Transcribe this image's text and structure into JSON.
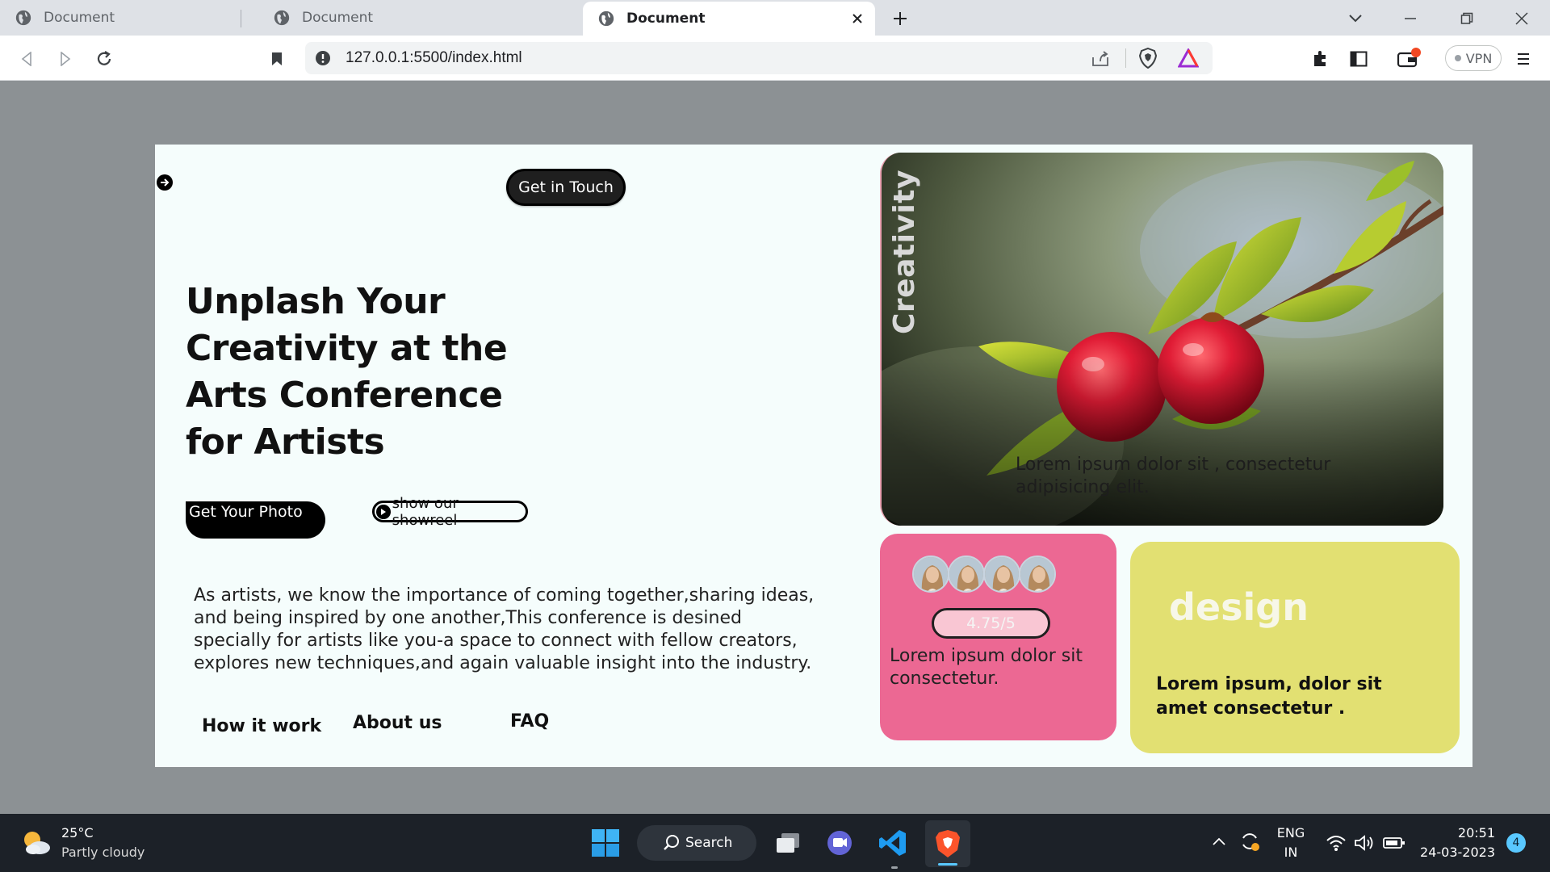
{
  "browser": {
    "tabs": [
      {
        "title": "Document",
        "active": false
      },
      {
        "title": "Document",
        "active": false
      },
      {
        "title": "Document",
        "active": true
      }
    ],
    "url": "127.0.0.1:5500/index.html",
    "vpn_label": "VPN"
  },
  "page": {
    "cta_touch": "Get in Touch",
    "hero_title": "Unplash Your Creativity at the Arts Conference for Artists",
    "btn_photo": "Get Your Photo",
    "btn_showreel": "show our showreel",
    "intro": "As artists, we know the importance of coming together,sharing ideas, and being inspired by one another,This conference is desined specially for artists like you-a space to connect with fellow creators, explores new techniques,and again valuable insight into the industry.",
    "nav": [
      "How it work",
      "About us",
      "FAQ"
    ],
    "photo_card": {
      "vertical_label": "Creativity",
      "caption": "Lorem ipsum dolor sit , consectetur adipisicing elit."
    },
    "rating_card": {
      "rating": "4.75/5",
      "text": "Lorem ipsum dolor sit consectetur."
    },
    "design_card": {
      "title": "design",
      "text": "Lorem ipsum, dolor sit amet consectetur ."
    }
  },
  "taskbar": {
    "weather_temp": "25°C",
    "weather_desc": "Partly cloudy",
    "search_label": "Search",
    "lang_top": "ENG",
    "lang_bottom": "IN",
    "time": "20:51",
    "date": "24-03-2023",
    "notification_count": "4"
  },
  "colors": {
    "page_bg": "#f5fdfc",
    "pink_card": "#ec6893",
    "yellow_card": "#e2e072",
    "viewport_bg": "#8c9194"
  }
}
